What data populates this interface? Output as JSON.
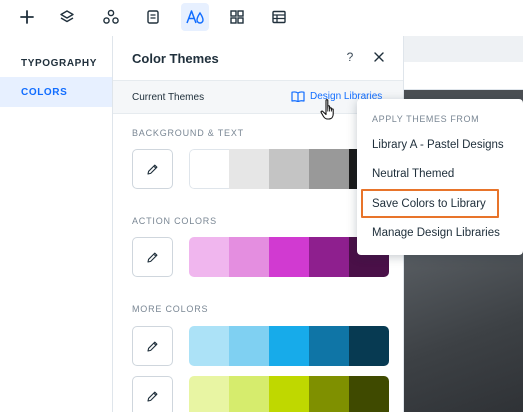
{
  "toolbar": {
    "items": [
      {
        "icon": "plus-icon"
      },
      {
        "icon": "layers-icon"
      },
      {
        "icon": "apps-icon"
      },
      {
        "icon": "pages-icon"
      },
      {
        "icon": "theme-icon",
        "active": true
      },
      {
        "icon": "grid-icon"
      },
      {
        "icon": "table-icon"
      }
    ]
  },
  "sidebar": {
    "items": [
      {
        "label": "TYPOGRAPHY",
        "active": false
      },
      {
        "label": "COLORS",
        "active": true
      }
    ]
  },
  "panel": {
    "title": "Color Themes",
    "help_label": "?",
    "current_label": "Current Themes",
    "design_libraries_label": "Design Libraries",
    "sections": {
      "background": {
        "label": "BACKGROUND & TEXT",
        "colors": [
          "#ffffff",
          "#e6e6e6",
          "#c4c4c4",
          "#999999",
          "#1a1a1a"
        ]
      },
      "action": {
        "label": "ACTION COLORS",
        "colors": [
          "#f0b6ee",
          "#e48ee0",
          "#d13ad1",
          "#8e1f8e",
          "#4a1048"
        ]
      },
      "more": {
        "label": "MORE COLORS",
        "rows": [
          [
            "#ace2f7",
            "#7fd0f2",
            "#17abea",
            "#0f75a6",
            "#073a52"
          ],
          [
            "#e8f5a3",
            "#d6ec6d",
            "#bfd800",
            "#7f9000",
            "#3f4a00"
          ]
        ]
      }
    }
  },
  "dropdown": {
    "heading": "APPLY THEMES FROM",
    "items": [
      "Library A - Pastel Designs",
      "Neutral Themed",
      "Save Colors to Library",
      "Manage Design Libraries"
    ],
    "highlight_color": "#e8742a"
  },
  "colors": {
    "accent": "#116dff",
    "active_bg": "#e7f0ff"
  }
}
